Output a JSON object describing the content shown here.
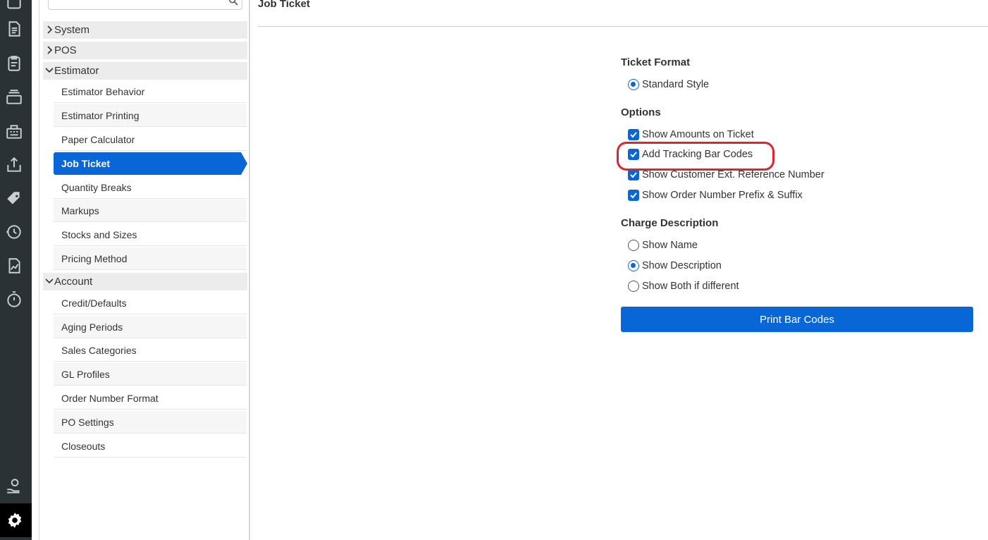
{
  "rail": {
    "icons": [
      "document-icon",
      "clipboard-icon",
      "layers-icon",
      "register-icon",
      "export-icon",
      "tag-icon",
      "history-icon",
      "report-chart-icon",
      "timer-icon",
      "payment-hand-icon",
      "settings-gear-icon"
    ]
  },
  "tree": {
    "groups": [
      {
        "label": "System",
        "expanded": false
      },
      {
        "label": "POS",
        "expanded": false
      },
      {
        "label": "Estimator",
        "expanded": true
      },
      {
        "label": "Account",
        "expanded": true
      }
    ],
    "estimator_items": [
      "Estimator Behavior",
      "Estimator Printing",
      "Paper Calculator",
      "Job Ticket",
      "Quantity Breaks",
      "Markups",
      "Stocks and Sizes",
      "Pricing Method"
    ],
    "account_items": [
      "Credit/Defaults",
      "Aging Periods",
      "Sales Categories",
      "GL Profiles",
      "Order Number Format",
      "PO Settings",
      "Closeouts"
    ],
    "active_item": "Job Ticket"
  },
  "main": {
    "title": "Job Ticket",
    "ticket_format": {
      "heading": "Ticket Format",
      "options": [
        {
          "label": "Standard Style",
          "selected": true
        }
      ]
    },
    "options": {
      "heading": "Options",
      "items": [
        {
          "label": "Show Amounts on Ticket",
          "checked": true
        },
        {
          "label": "Add Tracking Bar Codes",
          "checked": true
        },
        {
          "label": "Show Customer Ext. Reference Number",
          "checked": true
        },
        {
          "label": "Show Order Number Prefix & Suffix",
          "checked": true
        }
      ]
    },
    "charge_description": {
      "heading": "Charge Description",
      "options": [
        {
          "label": "Show Name",
          "selected": false
        },
        {
          "label": "Show Description",
          "selected": true
        },
        {
          "label": "Show Both if different",
          "selected": false
        }
      ]
    },
    "print_button": "Print Bar Codes"
  },
  "colors": {
    "accent": "#0866d6",
    "rail_bg": "#2b3236",
    "highlight": "#e0232e"
  }
}
